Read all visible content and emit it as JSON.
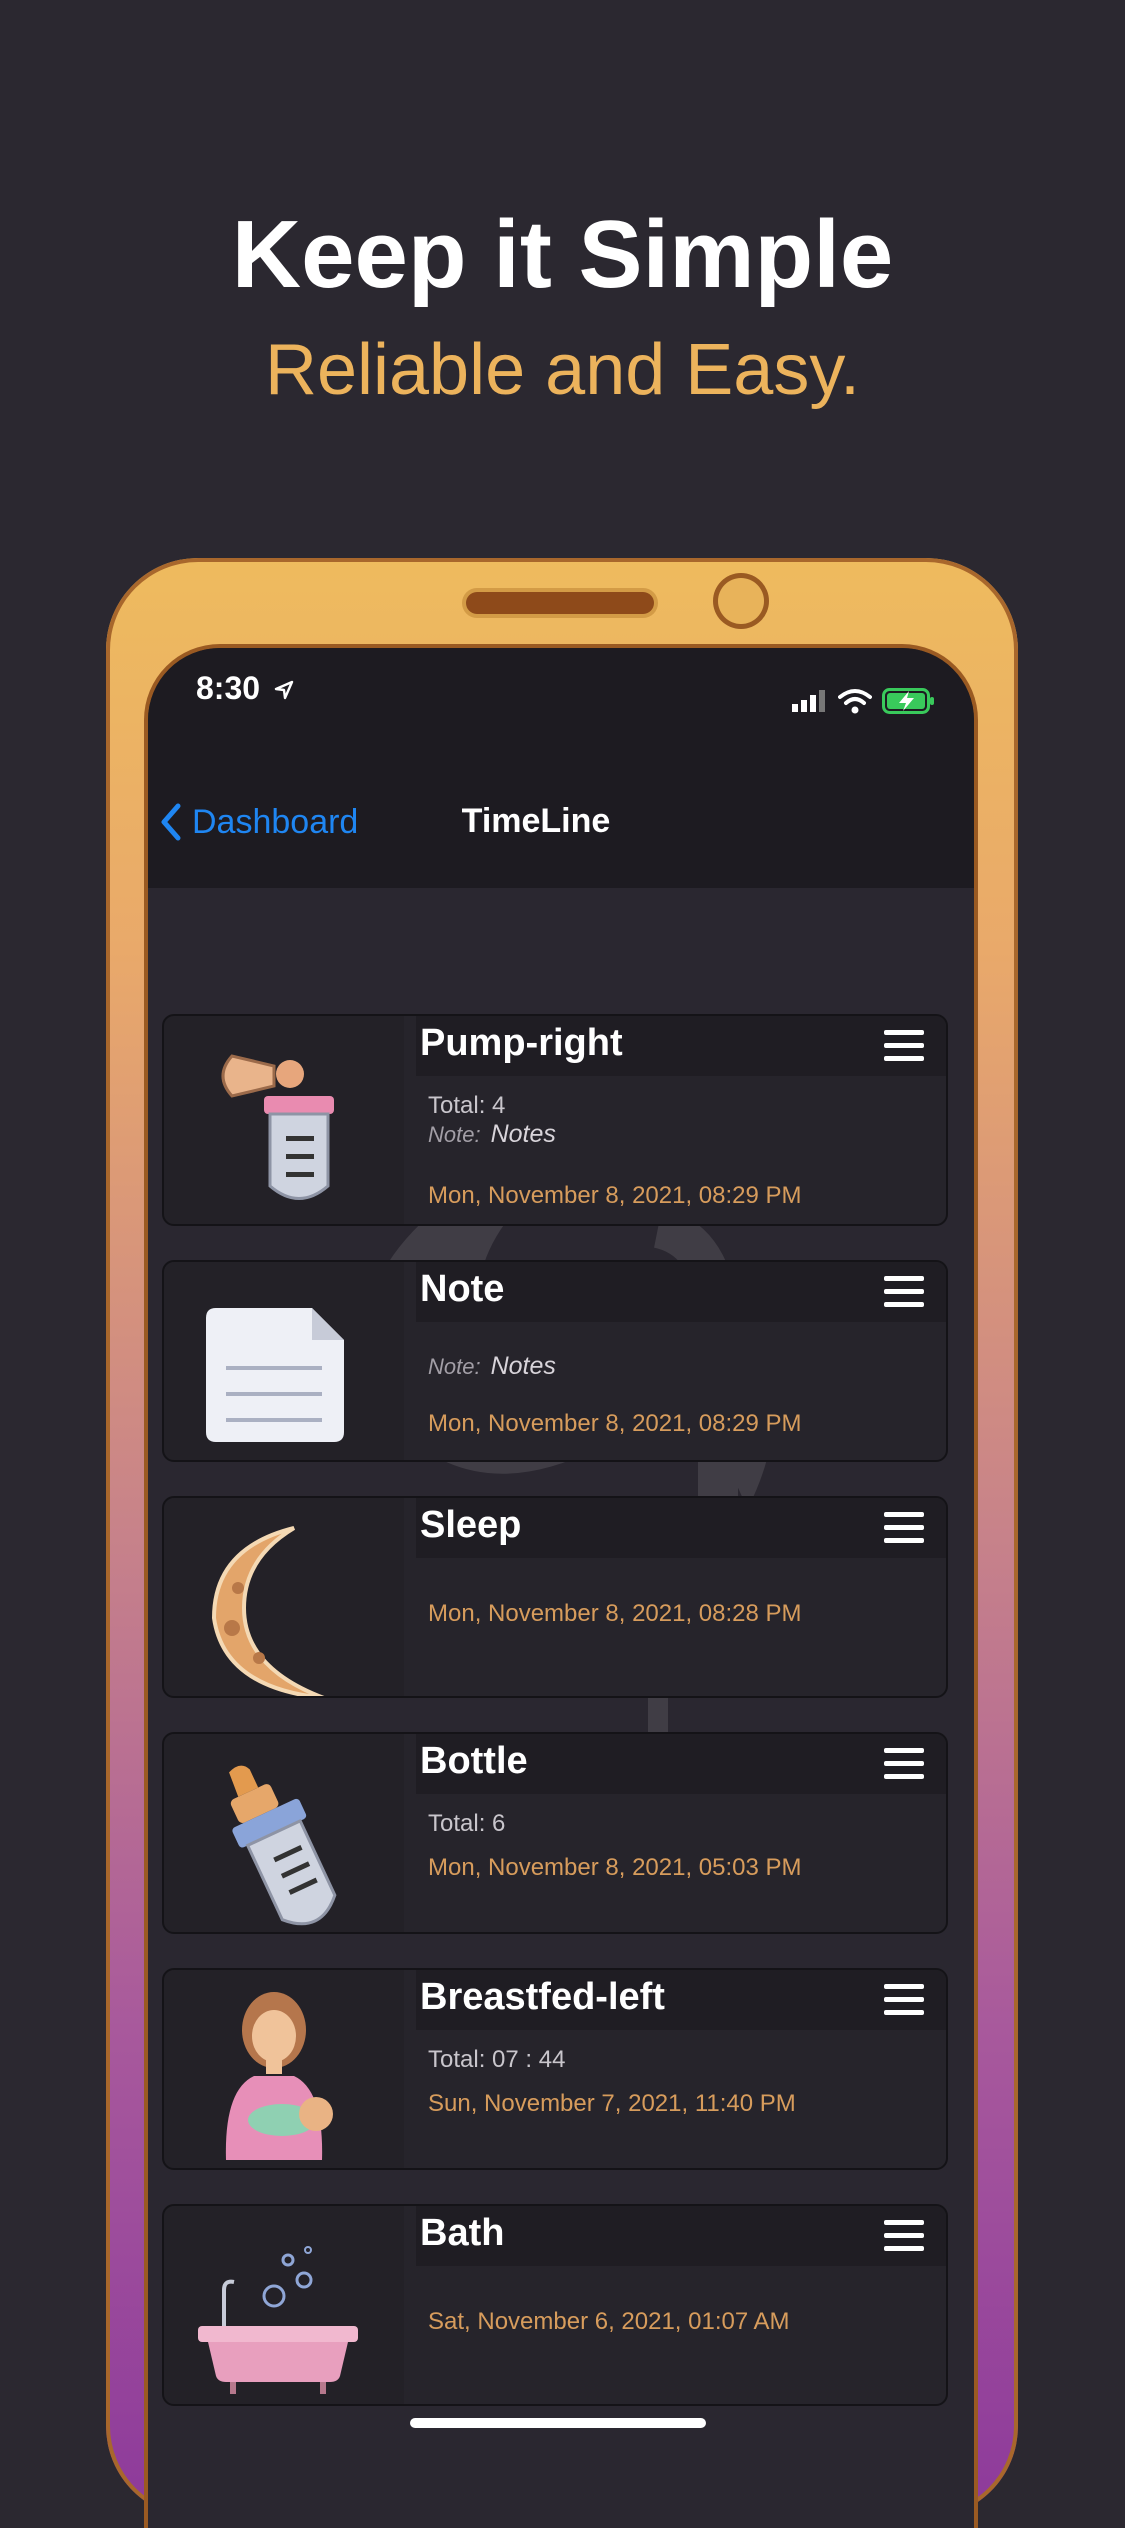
{
  "hero": {
    "title": "Keep it Simple",
    "subtitle": "Reliable and Easy."
  },
  "status": {
    "time": "8:30"
  },
  "nav": {
    "back_label": "Dashboard",
    "title": "TimeLine"
  },
  "entries": [
    {
      "title": "Pump-right",
      "total": "Total: 4",
      "note_label": "Note:",
      "note": "Notes",
      "date": "Mon, November 8, 2021, 08:29 PM",
      "icon": "breast-pump-icon"
    },
    {
      "title": "Note",
      "note_label": "Note:",
      "note": "Notes",
      "date": "Mon, November 8, 2021, 08:29 PM",
      "icon": "document-icon"
    },
    {
      "title": "Sleep",
      "date": "Mon, November 8, 2021, 08:28 PM",
      "icon": "moon-icon"
    },
    {
      "title": "Bottle",
      "total": "Total: 6",
      "date": "Mon, November 8, 2021, 05:03 PM",
      "icon": "baby-bottle-icon"
    },
    {
      "title": "Breastfed-left",
      "total": "Total: 07 : 44",
      "date": "Sun, November 7, 2021, 11:40 PM",
      "icon": "breastfeeding-mother-icon"
    },
    {
      "title": "Bath",
      "date": "Sat, November 6, 2021, 01:07 AM",
      "icon": "bathtub-icon"
    }
  ],
  "colors": {
    "accent": "#ecb35c",
    "link": "#1f86f2",
    "date": "#d79c5c"
  }
}
